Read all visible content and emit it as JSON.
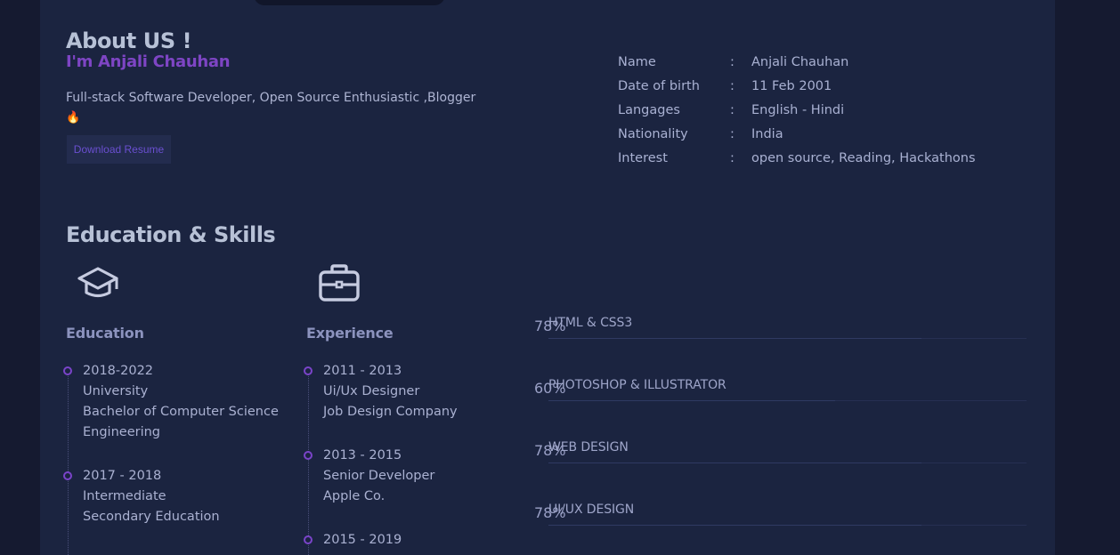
{
  "about": {
    "title": "About US !",
    "subtitle": "I'm Anjali Chauhan",
    "description": "Full-stack Software Developer, Open Source Enthusiastic ,Blogger",
    "emoji_icon": "fire-icon",
    "download_label": "Download Resume"
  },
  "info": [
    {
      "label": "Name",
      "colon": ":",
      "value": "Anjali Chauhan"
    },
    {
      "label": "Date of birth",
      "colon": ":",
      "value": "11 Feb 2001"
    },
    {
      "label": "Langages",
      "colon": ":",
      "value": "English - Hindi"
    },
    {
      "label": "Nationality",
      "colon": ":",
      "value": "India"
    },
    {
      "label": "Interest",
      "colon": ":",
      "value": "open source, Reading, Hackathons"
    }
  ],
  "skills_section": {
    "title": "Education & Skills",
    "education": {
      "icon": "graduation-cap-icon",
      "title": "Education",
      "items": [
        {
          "years": "2018-2022",
          "line1": "University",
          "line2": "Bachelor of Computer Science",
          "line3": "Engineering"
        },
        {
          "years": "2017 - 2018",
          "line1": "Intermediate",
          "line2": "Secondary Education"
        }
      ]
    },
    "experience": {
      "icon": "briefcase-icon",
      "title": "Experience",
      "items": [
        {
          "years": "2011 - 2013",
          "line1": "Ui/Ux Designer",
          "line2": "Job Design Company"
        },
        {
          "years": "2013 - 2015",
          "line1": "Senior Developer",
          "line2": "Apple Co."
        },
        {
          "years": "2015 - 2019"
        }
      ]
    },
    "skills": [
      {
        "name": "HTML & CSS3",
        "percent": "78%",
        "value": 78
      },
      {
        "name": "PHOTOSHOP & ILLUSTRATOR",
        "percent": "60%",
        "value": 60
      },
      {
        "name": "WEB DESIGN",
        "percent": "78%",
        "value": 78
      },
      {
        "name": "UI/UX DESIGN",
        "percent": "78%",
        "value": 78
      }
    ]
  },
  "colors": {
    "background": "#151a30",
    "panel": "#1b2440",
    "accent": "#7e45c4",
    "heading": "#b7c1d6"
  }
}
